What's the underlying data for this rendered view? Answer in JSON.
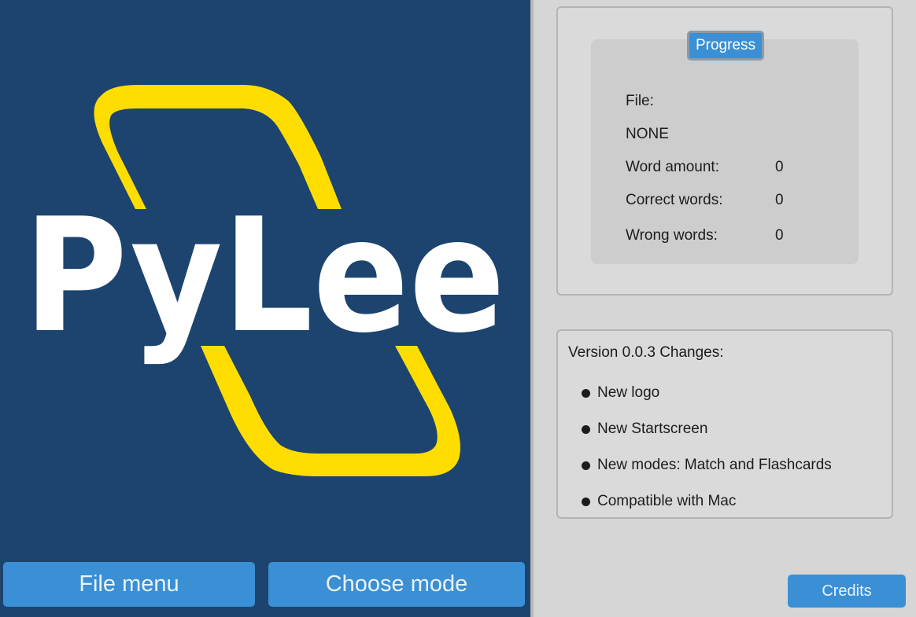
{
  "left_panel": {
    "logo": {
      "text": "PyLee",
      "ring_color": "#ffdd00",
      "text_color": "#ffffff",
      "background": "#1c446e"
    },
    "file_menu_label": "File menu",
    "choose_mode_label": "Choose mode"
  },
  "progress": {
    "title": "Progress",
    "file_label": "File:",
    "file_value": "NONE",
    "word_amount_label": "Word amount:",
    "word_amount_value": "0",
    "correct_label": "Correct words:",
    "correct_value": "0",
    "wrong_label": "Wrong words:",
    "wrong_value": "0"
  },
  "changes": {
    "title": "Version 0.0.3 Changes:",
    "items": [
      "New logo",
      "New Startscreen",
      "New modes: Match and Flashcards",
      "Compatible with Mac"
    ]
  },
  "credits_label": "Credits",
  "colors": {
    "accent": "#3b8fd4",
    "panel": "#dadada"
  }
}
